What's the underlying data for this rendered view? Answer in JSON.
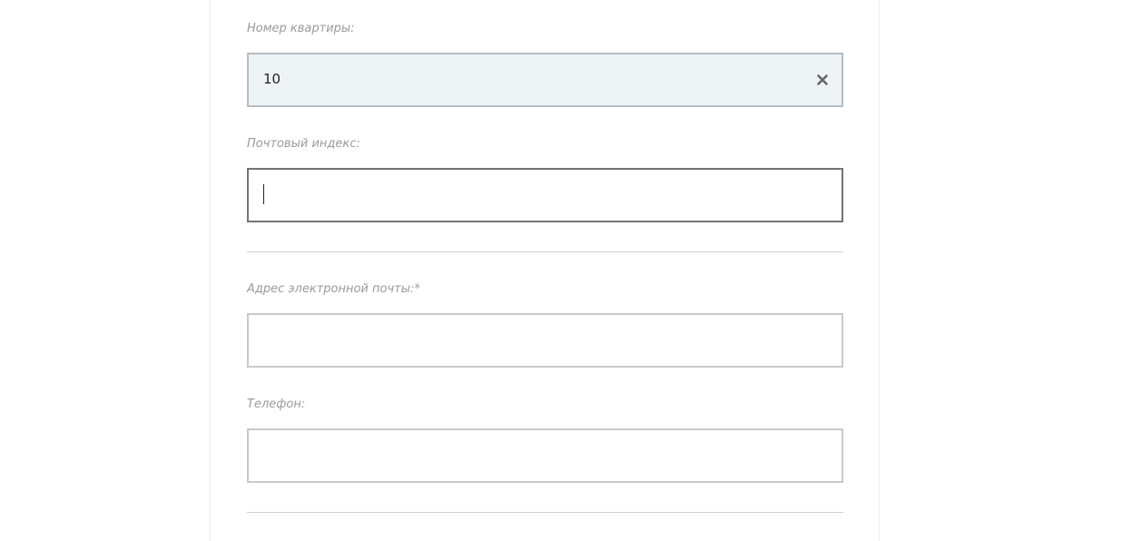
{
  "form": {
    "apartment": {
      "label": "Номер квартиры:",
      "value": "10",
      "clear_icon": "close-icon"
    },
    "postal_code": {
      "label": "Почтовый индекс:",
      "value": ""
    },
    "email": {
      "label": "Адрес электронной почты:*",
      "value": ""
    },
    "phone": {
      "label": "Телефон:",
      "value": ""
    }
  },
  "colors": {
    "filled_background": "#edf2f5",
    "label": "#9a9a9a",
    "border": "#c9c9c9",
    "focused_border": "#747474"
  }
}
